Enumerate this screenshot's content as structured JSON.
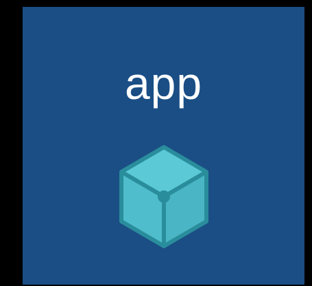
{
  "tile": {
    "label": "app",
    "background_color": "#1a4e85",
    "icon": "cube-icon"
  },
  "colors": {
    "page_background": "#000000",
    "cube_face": "#4fbdcc",
    "cube_top": "#5cc9d6",
    "cube_outline": "#2a8d9c"
  }
}
